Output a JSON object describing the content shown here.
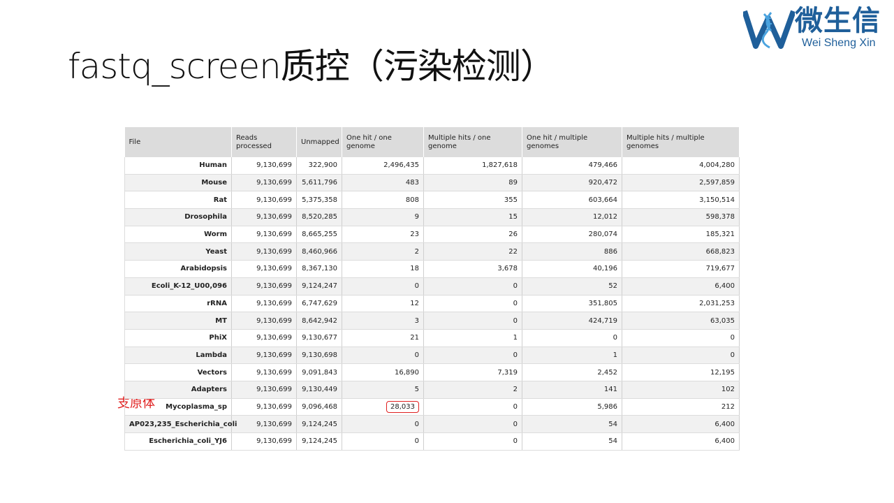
{
  "title": "fastq_screen质控（污染检测）",
  "logo": {
    "cn": "微生信",
    "en": "Wei Sheng Xin",
    "brand_color": "#1f5f9a",
    "accent_color": "#4aa3df"
  },
  "annotation": {
    "text": "支原体",
    "color": "#e02020"
  },
  "table": {
    "headers": [
      "File",
      "Reads processed",
      "Unmapped",
      "One hit / one genome",
      "Multiple hits / one genome",
      "One hit / multiple genomes",
      "Multiple hits / multiple genomes"
    ],
    "rows": [
      [
        "Human",
        "9,130,699",
        "322,900",
        "2,496,435",
        "1,827,618",
        "479,466",
        "4,004,280"
      ],
      [
        "Mouse",
        "9,130,699",
        "5,611,796",
        "483",
        "89",
        "920,472",
        "2,597,859"
      ],
      [
        "Rat",
        "9,130,699",
        "5,375,358",
        "808",
        "355",
        "603,664",
        "3,150,514"
      ],
      [
        "Drosophila",
        "9,130,699",
        "8,520,285",
        "9",
        "15",
        "12,012",
        "598,378"
      ],
      [
        "Worm",
        "9,130,699",
        "8,665,255",
        "23",
        "26",
        "280,074",
        "185,321"
      ],
      [
        "Yeast",
        "9,130,699",
        "8,460,966",
        "2",
        "22",
        "886",
        "668,823"
      ],
      [
        "Arabidopsis",
        "9,130,699",
        "8,367,130",
        "18",
        "3,678",
        "40,196",
        "719,677"
      ],
      [
        "Ecoli_K-12_U00,096",
        "9,130,699",
        "9,124,247",
        "0",
        "0",
        "52",
        "6,400"
      ],
      [
        "rRNA",
        "9,130,699",
        "6,747,629",
        "12",
        "0",
        "351,805",
        "2,031,253"
      ],
      [
        "MT",
        "9,130,699",
        "8,642,942",
        "3",
        "0",
        "424,719",
        "63,035"
      ],
      [
        "PhiX",
        "9,130,699",
        "9,130,677",
        "21",
        "1",
        "0",
        "0"
      ],
      [
        "Lambda",
        "9,130,699",
        "9,130,698",
        "0",
        "0",
        "1",
        "0"
      ],
      [
        "Vectors",
        "9,130,699",
        "9,091,843",
        "16,890",
        "7,319",
        "2,452",
        "12,195"
      ],
      [
        "Adapters",
        "9,130,699",
        "9,130,449",
        "5",
        "2",
        "141",
        "102"
      ],
      [
        "Mycoplasma_sp",
        "9,130,699",
        "9,096,468",
        "28,033",
        "0",
        "5,986",
        "212"
      ],
      [
        "AP023,235_Escherichia_coli",
        "9,130,699",
        "9,124,245",
        "0",
        "0",
        "54",
        "6,400"
      ],
      [
        "Escherichia_coli_YJ6",
        "9,130,699",
        "9,124,245",
        "0",
        "0",
        "54",
        "6,400"
      ]
    ],
    "highlight": {
      "row": 14,
      "col": 3,
      "color": "#e02020"
    }
  }
}
